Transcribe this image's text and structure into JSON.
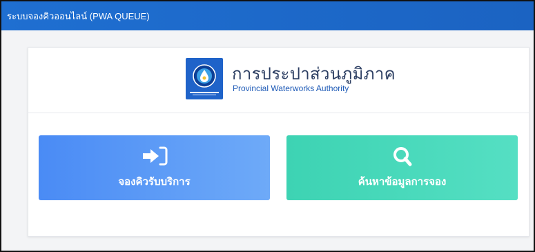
{
  "header": {
    "title": "ระบบจองคิวออนไลน์ (PWA QUEUE)"
  },
  "brand": {
    "name_th": "การประปาส่วนภูมิภาค",
    "name_en": "Provincial Waterworks Authority"
  },
  "actions": {
    "book_label": "จองคิวรับบริการ",
    "book_icon": "sign-in-arrow-icon",
    "search_label": "ค้นหาข้อมูลการจอง",
    "search_icon": "magnifier-icon"
  },
  "colors": {
    "header": "#1f6fd1",
    "book_button": "#5a98f6",
    "search_button": "#45d8ba",
    "brand_text": "#2c3e62"
  }
}
